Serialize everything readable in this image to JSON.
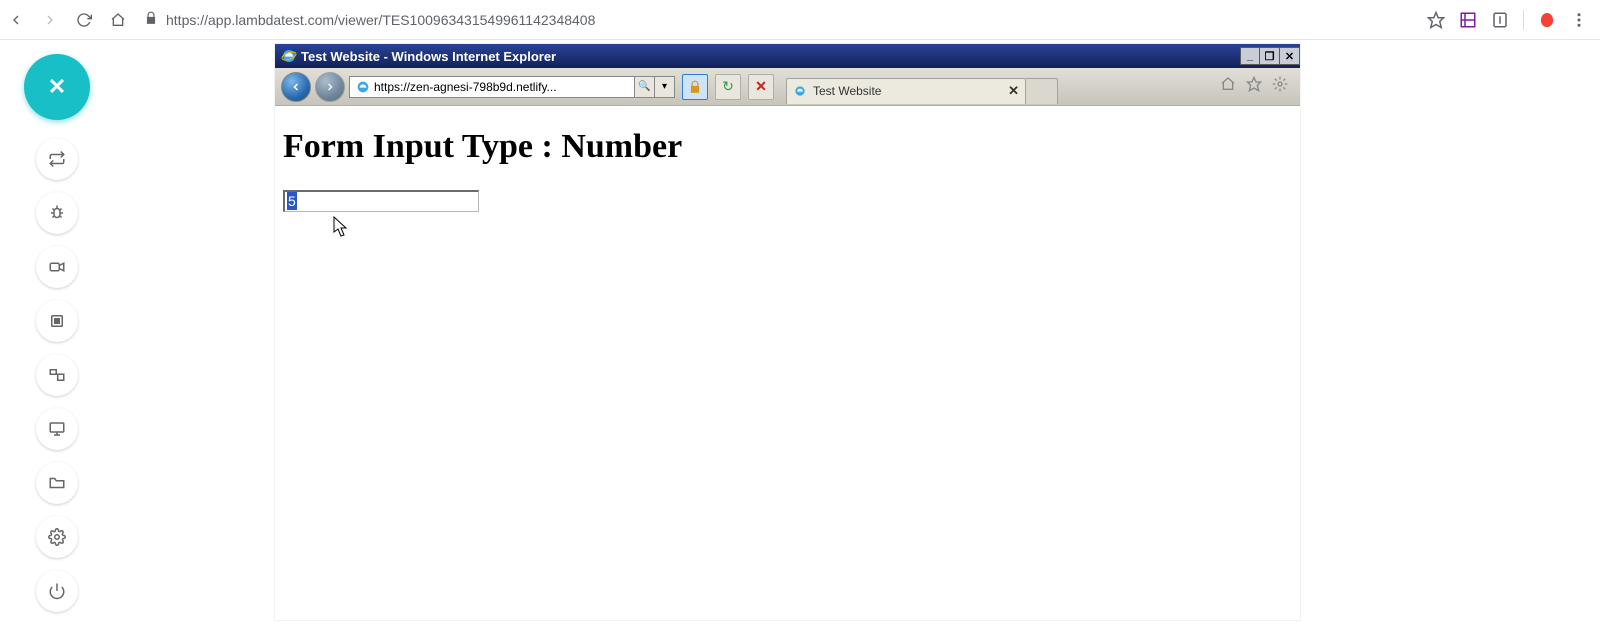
{
  "chrome": {
    "url": "https://app.lambdatest.com/viewer/TES100963431549961142348408"
  },
  "sidebar": {
    "close_label": "✕"
  },
  "ie": {
    "window_title": "Test Website - Windows Internet Explorer",
    "url": "https://zen-agnesi-798b9d.netlify...",
    "tab_title": "Test Website",
    "minimize": "_",
    "maximize": "❐",
    "close": "✕",
    "search_glyph": "🔍",
    "dropdown_glyph": "▾",
    "refresh_glyph": "↻",
    "stop_glyph": "✕",
    "tab_close": "✕"
  },
  "page": {
    "heading": "Form Input Type : Number",
    "input_value": "5"
  }
}
